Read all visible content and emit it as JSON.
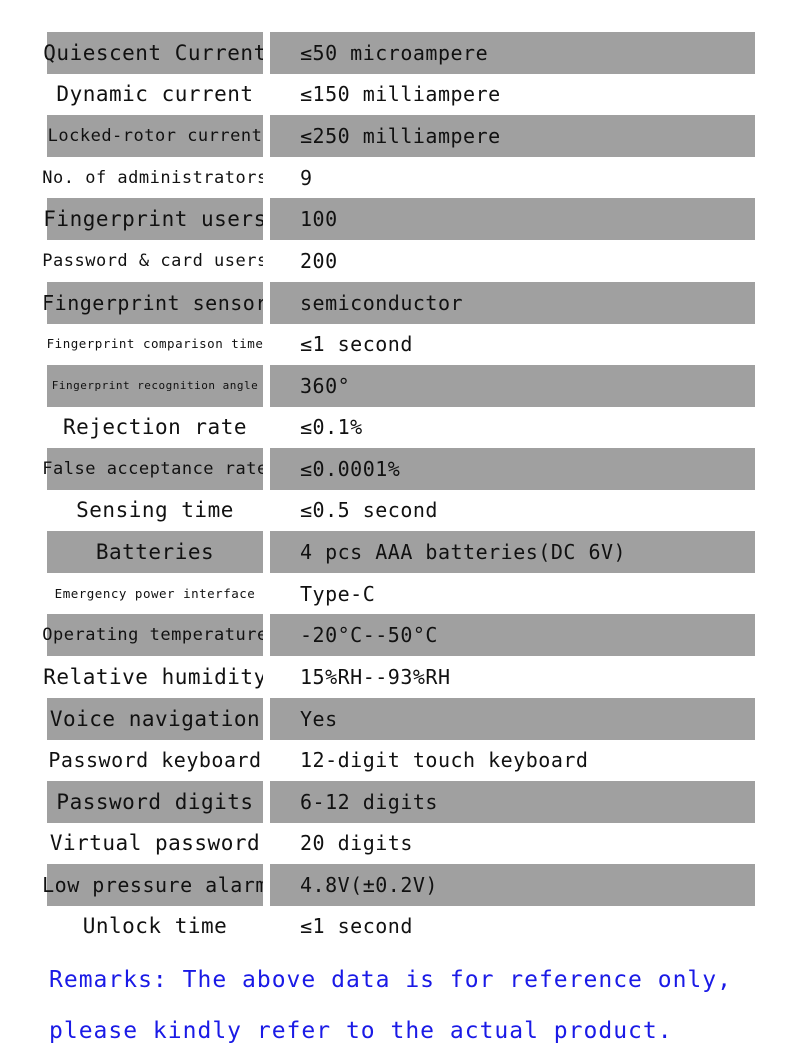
{
  "specs": [
    {
      "label": "Quiescent Current",
      "value": "≤50 microampere",
      "shaded": true,
      "size": "fs-xl"
    },
    {
      "label": "Dynamic current",
      "value": "≤150 milliampere",
      "shaded": false,
      "size": "fs-xl"
    },
    {
      "label": "Locked-rotor current",
      "value": "≤250 milliampere",
      "shaded": true,
      "size": "fs-m"
    },
    {
      "label": "No. of administrators",
      "value": "9",
      "shaded": false,
      "size": "fs-m"
    },
    {
      "label": "Fingerprint users",
      "value": "100",
      "shaded": true,
      "size": "fs-xl"
    },
    {
      "label": "Password & card users",
      "value": "200",
      "shaded": false,
      "size": "fs-m"
    },
    {
      "label": "Fingerprint sensor",
      "value": "semiconductor",
      "shaded": true,
      "size": "fs-l"
    },
    {
      "label": "Fingerprint comparison time",
      "value": "≤1 second",
      "shaded": false,
      "size": "fs-xs"
    },
    {
      "label": "Fingerprint recognition angle",
      "value": "360°",
      "shaded": true,
      "size": "fs-xxs"
    },
    {
      "label": "Rejection rate",
      "value": "≤0.1%",
      "shaded": false,
      "size": "fs-xl"
    },
    {
      "label": "False acceptance rate",
      "value": "≤0.0001%",
      "shaded": true,
      "size": "fs-m"
    },
    {
      "label": "Sensing time",
      "value": "≤0.5 second",
      "shaded": false,
      "size": "fs-xl"
    },
    {
      "label": "Batteries",
      "value": "4 pcs AAA batteries(DC 6V)",
      "shaded": true,
      "size": "fs-xl"
    },
    {
      "label": "Emergency power interface",
      "value": "Type-C",
      "shaded": false,
      "size": "fs-xs"
    },
    {
      "label": "Operating temperature",
      "value": "-20°C--50°C",
      "shaded": true,
      "size": "fs-m"
    },
    {
      "label": "Relative humidity",
      "value": "15%RH--93%RH",
      "shaded": false,
      "size": "fs-xl"
    },
    {
      "label": "Voice navigation",
      "value": "Yes",
      "shaded": true,
      "size": "fs-xl"
    },
    {
      "label": "Password keyboard",
      "value": "12-digit touch keyboard",
      "shaded": false,
      "size": "fs-l"
    },
    {
      "label": "Password digits",
      "value": "6-12 digits",
      "shaded": true,
      "size": "fs-xl"
    },
    {
      "label": "Virtual password",
      "value": "20 digits",
      "shaded": false,
      "size": "fs-xl"
    },
    {
      "label": "Low pressure alarm",
      "value": "4.8V(±0.2V)",
      "shaded": true,
      "size": "fs-l"
    },
    {
      "label": "Unlock time",
      "value": "≤1 second",
      "shaded": false,
      "size": "fs-xl"
    }
  ],
  "remarks": {
    "line1": "Remarks: The above data is for reference only,",
    "line2": "please kindly refer to the actual product.",
    "color": "#1a1ae6"
  },
  "colors": {
    "shaded_row": "#a0a0a0",
    "background": "#ffffff",
    "text": "#111111"
  }
}
